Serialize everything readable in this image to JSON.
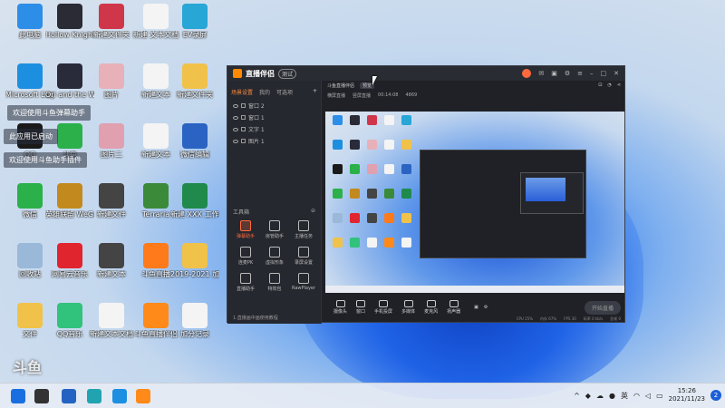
{
  "desktop": {
    "icons": [
      {
        "label": "此电脑",
        "color": "#2d8ee8",
        "icon": "computer-icon"
      },
      {
        "label": "Hollow Knight",
        "color": "#2b2b35",
        "icon": "game-icon"
      },
      {
        "label": "新建文件夹",
        "color": "#d0364a",
        "icon": "app-icon"
      },
      {
        "label": "新建 文本文档",
        "color": "#f4f4f4",
        "icon": "document-icon"
      },
      {
        "label": "EV录屏",
        "color": "#28a6d6",
        "icon": "app-icon"
      },
      {
        "label": "Microsoft Edge",
        "color": "#1d8fe0",
        "icon": "edge-icon"
      },
      {
        "label": "Ori and the Will of th",
        "color": "#2a2b3a",
        "icon": "game-icon"
      },
      {
        "label": "图片",
        "color": "#e8b0b8",
        "icon": "image-icon"
      },
      {
        "label": "新建文本",
        "color": "#f4f4f4",
        "icon": "document-icon"
      },
      {
        "label": "新建文件夹",
        "color": "#f0c24a",
        "icon": "folder-icon"
      },
      {
        "label": "QQ",
        "color": "#1a1a1a",
        "icon": "qq-icon"
      },
      {
        "label": "斗鱼",
        "color": "#2bb04a",
        "icon": "app-icon"
      },
      {
        "label": "图片二",
        "color": "#e0a0b0",
        "icon": "image-icon"
      },
      {
        "label": "新建文本",
        "color": "#f4f4f4",
        "icon": "document-icon"
      },
      {
        "label": "微信编辑",
        "color": "#2a63c2",
        "icon": "word-icon"
      },
      {
        "label": "微信",
        "color": "#2bb04a",
        "icon": "wechat-icon"
      },
      {
        "label": "英雄联盟 WeGame版",
        "color": "#c28a1e",
        "icon": "game-icon"
      },
      {
        "label": "新建文件",
        "color": "#444",
        "icon": "app-icon"
      },
      {
        "label": "Terraria",
        "color": "#3a8a3a",
        "icon": "game-icon"
      },
      {
        "label": "新建 XXX 工作表",
        "color": "#1f8a4c",
        "icon": "excel-icon"
      },
      {
        "label": "回收站",
        "color": "#9ab8d8",
        "icon": "recycle-bin-icon"
      },
      {
        "label": "网易云音乐",
        "color": "#e0252f",
        "icon": "music-icon"
      },
      {
        "label": "新建文本",
        "color": "#444",
        "icon": "app-icon"
      },
      {
        "label": "斗鱼直播",
        "color": "#ff7a1a",
        "icon": "douyu-icon"
      },
      {
        "label": "2019-2021 加分汇总表",
        "color": "#f0c24a",
        "icon": "folder-icon"
      },
      {
        "label": "文件",
        "color": "#f0c24a",
        "icon": "folder-icon"
      },
      {
        "label": "QQ音乐",
        "color": "#31c27c",
        "icon": "music-icon"
      },
      {
        "label": "新建文本文档",
        "color": "#f4f4f4",
        "icon": "document-icon"
      },
      {
        "label": "斗鱼直播伴侣",
        "color": "#ff8a1a",
        "icon": "douyu-icon"
      },
      {
        "label": "加分记录",
        "color": "#f4f4f4",
        "icon": "document-icon"
      }
    ],
    "toasts": [
      "欢迎使用斗鱼弹幕助手",
      "此应用已启动",
      "欢迎使用斗鱼助手插件"
    ],
    "watermark": "斗鱼"
  },
  "window": {
    "app_name": "直播伴侣",
    "version_badge": "测试",
    "tabs": [
      "场景设置",
      "我的",
      "可选项"
    ],
    "add_scene": "+",
    "scenes": [
      "窗口 2",
      "窗口 1",
      "文字 1",
      "图片 1"
    ],
    "tools_header": "工具箱",
    "tools": [
      "弹幕助手",
      "房管助手",
      "主播任务",
      "连麦PK",
      "虚拟形象",
      "录屏设置",
      "直播助手",
      "特效包",
      "RawPlayer"
    ],
    "left_footer": "1.直播画中画使用教程",
    "main_top_title": "斗鱼直播伴侣",
    "main_top_badge": "预览",
    "main_sub": [
      "横屏直播",
      "竖屏直播",
      "00:14:08",
      "4869"
    ],
    "controls": [
      "摄像头",
      "窗口",
      "手机投屏",
      "多媒体",
      "麦克风",
      "扬声器"
    ],
    "go_live": "开始直播",
    "status_items": [
      "CPU 25%",
      "内存 67%",
      "FPS 30",
      "码率 0 kb/s",
      "丢帧 0"
    ]
  },
  "taskbar": {
    "apps": [
      {
        "name": "start",
        "color": "#1a6fe0"
      },
      {
        "name": "search",
        "color": "#333"
      },
      {
        "name": "app-k",
        "color": "#2563c2"
      },
      {
        "name": "wechat",
        "color": "#21a3b0"
      },
      {
        "name": "edge",
        "color": "#1d8fe0"
      },
      {
        "name": "douyu",
        "color": "#ff8a1a"
      }
    ],
    "ime": "英",
    "time": "15:26",
    "date": "2021/11/23",
    "notifications": "2"
  }
}
